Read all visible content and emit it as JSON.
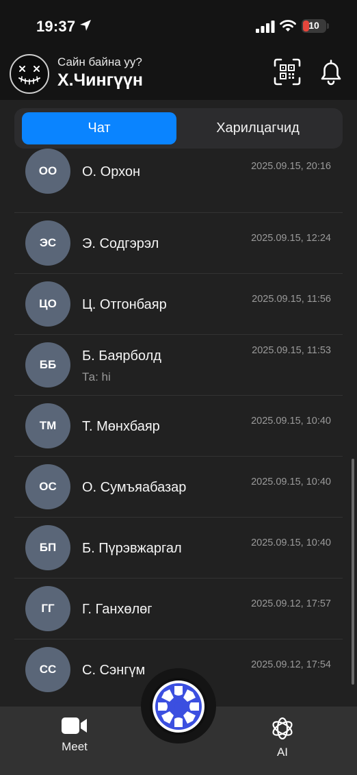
{
  "status_bar": {
    "time": "19:37",
    "battery": "10"
  },
  "header": {
    "greeting": "Сайн байна уу?",
    "username": "Х.Чингүүн"
  },
  "tabs": [
    {
      "label": "Чат",
      "active": true
    },
    {
      "label": "Харилцагчид",
      "active": false
    }
  ],
  "chats": [
    {
      "initials": "ОО",
      "name": "О. Орхон",
      "time": "2025.09.15, 20:16",
      "preview": ""
    },
    {
      "initials": "ЭС",
      "name": "Э. Содгэрэл",
      "time": "2025.09.15, 12:24",
      "preview": ""
    },
    {
      "initials": "ЦО",
      "name": "Ц. Отгонбаяр",
      "time": "2025.09.15, 11:56",
      "preview": ""
    },
    {
      "initials": "ББ",
      "name": "Б. Баярболд",
      "time": "2025.09.15, 11:53",
      "preview": "Та: hi"
    },
    {
      "initials": "ТМ",
      "name": "Т. Мөнхбаяр",
      "time": "2025.09.15, 10:40",
      "preview": ""
    },
    {
      "initials": "ОС",
      "name": "О. Сумъяабазар",
      "time": "2025.09.15, 10:40",
      "preview": ""
    },
    {
      "initials": "БП",
      "name": "Б. Пүрэвжаргал",
      "time": "2025.09.15, 10:40",
      "preview": ""
    },
    {
      "initials": "ГГ",
      "name": "Г. Ганхөлөг",
      "time": "2025.09.12, 17:57",
      "preview": ""
    },
    {
      "initials": "СС",
      "name": "С. Сэнгүм",
      "time": "2025.09.12, 17:54",
      "preview": ""
    }
  ],
  "bottom_nav": {
    "meet_label": "Meet",
    "ai_label": "AI"
  },
  "colors": {
    "accent": "#0a84ff",
    "avatar_bg": "#5a6678",
    "panel": "#212121",
    "fab": "#3b4fe0"
  }
}
